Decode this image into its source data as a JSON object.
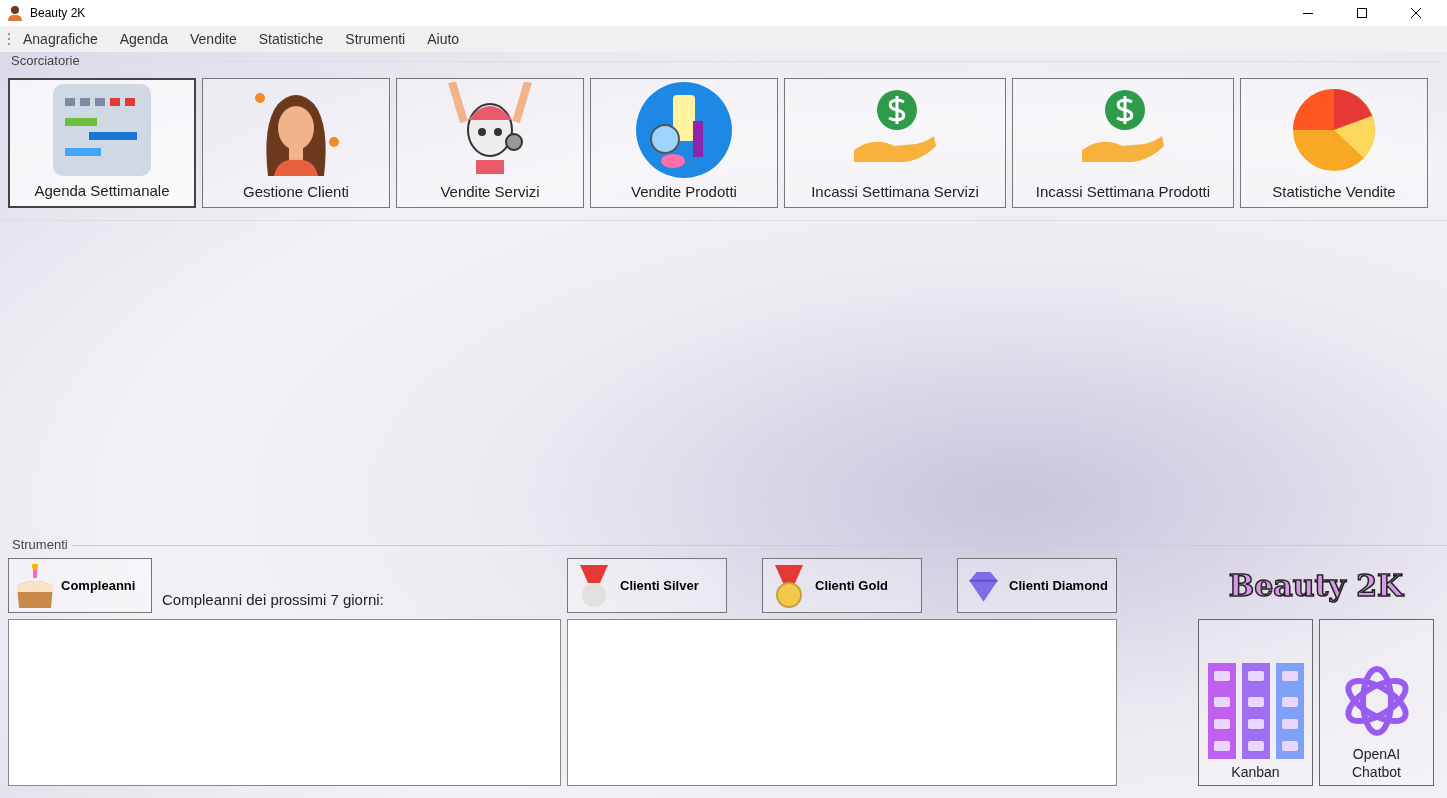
{
  "window": {
    "title": "Beauty 2K"
  },
  "menu": [
    "Anagrafiche",
    "Agenda",
    "Vendite",
    "Statistiche",
    "Strumenti",
    "Aiuto"
  ],
  "shortcuts": {
    "title": "Scorciatorie",
    "buttons": [
      {
        "label": "Agenda Settimanale",
        "selected": true
      },
      {
        "label": "Gestione Clienti",
        "selected": false
      },
      {
        "label": "Vendite Servizi",
        "selected": false
      },
      {
        "label": "Vendite Prodotti",
        "selected": false
      },
      {
        "label": "Incassi Settimana Servizi",
        "selected": false
      },
      {
        "label": "Incassi Settimana Prodotti",
        "selected": false
      },
      {
        "label": "Statistiche Vendite",
        "selected": false
      }
    ]
  },
  "tools": {
    "title": "Strumenti",
    "birthday_button": "Compleanni",
    "birthday_label": "Compleanni dei prossimi 7 giorni:",
    "client_buttons": [
      "Clienti Silver",
      "Clienti Gold",
      "Clienti Diamond"
    ],
    "logo": "Beauty 2K",
    "side_buttons": [
      "Kanban",
      "OpenAI Chatbot"
    ]
  }
}
